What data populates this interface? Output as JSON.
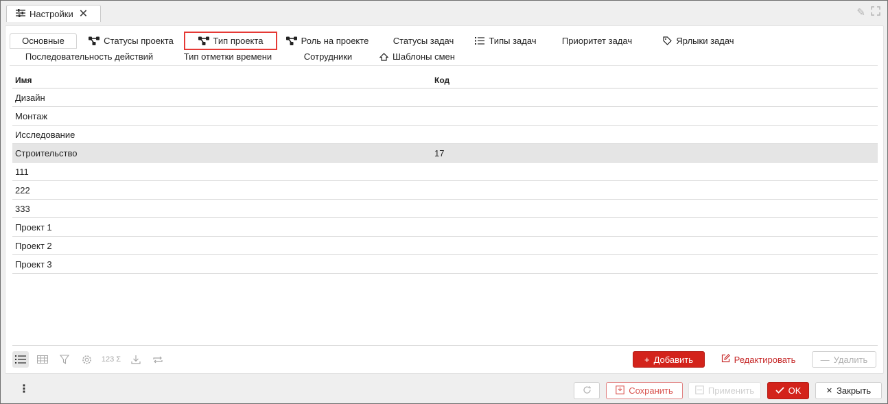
{
  "window_tab": {
    "title": "Настройки",
    "icon": "sliders-icon"
  },
  "tabs_row1": [
    {
      "label": "Основные",
      "icon": ""
    },
    {
      "label": "Статусы проекта",
      "icon": "nodes-icon"
    },
    {
      "label": "Тип проекта",
      "icon": "nodes-icon"
    },
    {
      "label": "Роль на проекте",
      "icon": "nodes-icon"
    },
    {
      "label": "Статусы задач",
      "icon": ""
    },
    {
      "label": "Типы задач",
      "icon": "list-icon"
    },
    {
      "label": "Приоритет задач",
      "icon": ""
    },
    {
      "label": "Ярлыки задач",
      "icon": "tag-icon"
    }
  ],
  "tabs_row2": [
    {
      "label": "Последовательность действий",
      "icon": ""
    },
    {
      "label": "Тип отметки времени",
      "icon": ""
    },
    {
      "label": "Сотрудники",
      "icon": ""
    },
    {
      "label": "Шаблоны смен",
      "icon": "home-outline-icon"
    }
  ],
  "grid": {
    "columns": [
      "Имя",
      "Код"
    ],
    "rows": [
      [
        "Дизайн",
        ""
      ],
      [
        "Монтаж",
        ""
      ],
      [
        "Исследование",
        ""
      ],
      [
        "Строительство",
        "17"
      ],
      [
        "111",
        ""
      ],
      [
        "222",
        ""
      ],
      [
        "333",
        ""
      ],
      [
        "Проект 1",
        ""
      ],
      [
        "Проект 2",
        ""
      ],
      [
        "Проект 3",
        ""
      ]
    ],
    "selected_row": 3
  },
  "grid_tools": {
    "sum_label": "123 Σ"
  },
  "actions": {
    "add": "Добавить",
    "edit": "Редактировать",
    "delete": "Удалить"
  },
  "footer": {
    "save": "Сохранить",
    "apply": "Применить",
    "ok": "OK",
    "close": "Закрыть"
  },
  "colors": {
    "accent": "#d3231b",
    "highlight": "#e53935",
    "selected_row": "#e5e5e5"
  }
}
